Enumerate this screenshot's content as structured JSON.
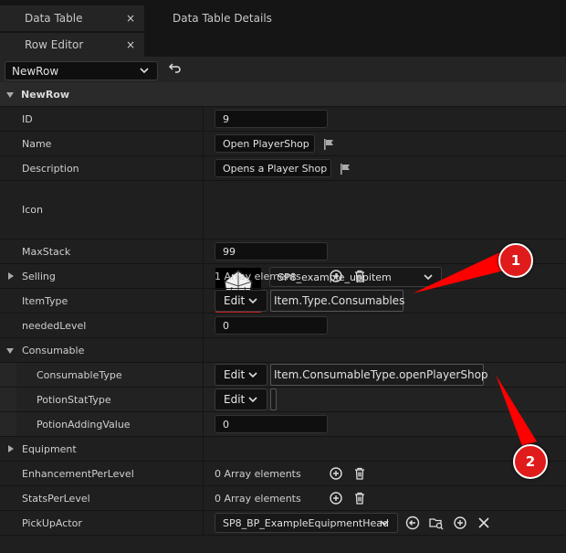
{
  "tabs": [
    {
      "label": "Data Table",
      "close": "×"
    },
    {
      "label": "Data Table Details"
    },
    {
      "label": "Row Editor",
      "close": "×"
    }
  ],
  "toolbar": {
    "row_name": "NewRow"
  },
  "section": {
    "title": "NewRow"
  },
  "props": {
    "id": {
      "label": "ID",
      "value": "9"
    },
    "name": {
      "label": "Name",
      "value": "Open PlayerShop"
    },
    "description": {
      "label": "Description",
      "value": "Opens a Player Shop"
    },
    "icon": {
      "label": "Icon",
      "asset": "SP8_example_uppitem"
    },
    "maxstack": {
      "label": "MaxStack",
      "value": "99"
    },
    "selling": {
      "label": "Selling",
      "value": "1 Array elements"
    },
    "itemtype": {
      "label": "ItemType",
      "edit": "Edit",
      "tag": "Item.Type.Consumables"
    },
    "neededlevel": {
      "label": "neededLevel",
      "value": "0"
    },
    "consumable": {
      "label": "Consumable"
    },
    "consumabletype": {
      "label": "ConsumableType",
      "edit": "Edit",
      "tag": "Item.ConsumableType.openPlayerShop"
    },
    "potionstattype": {
      "label": "PotionStatType",
      "edit": "Edit",
      "tag": ""
    },
    "potionaddingvalue": {
      "label": "PotionAddingValue",
      "value": "0"
    },
    "equipment": {
      "label": "Equipment"
    },
    "enhancement": {
      "label": "EnhancementPerLevel",
      "value": "0 Array elements"
    },
    "stats": {
      "label": "StatsPerLevel",
      "value": "0 Array elements"
    },
    "pickup": {
      "label": "PickUpActor",
      "asset": "SP8_BP_ExampleEquipmentHead"
    }
  },
  "annotations": [
    {
      "number": "1",
      "color": "#e01b1b"
    },
    {
      "number": "2",
      "color": "#e01b1b"
    }
  ]
}
